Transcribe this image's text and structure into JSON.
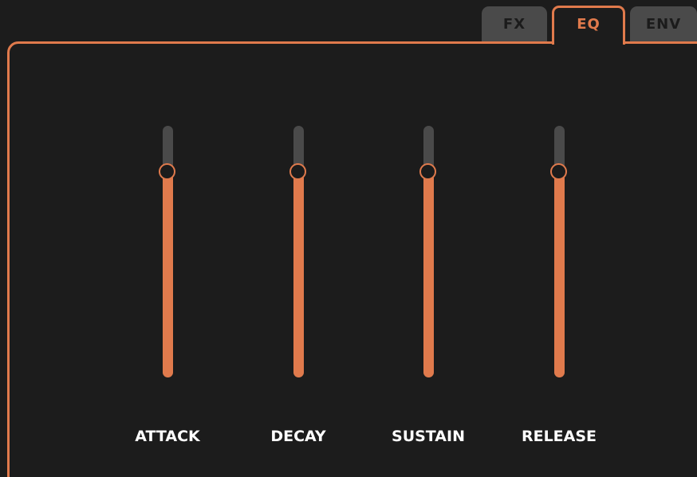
{
  "tabs": [
    {
      "label": "FX",
      "active": false
    },
    {
      "label": "EQ",
      "active": true
    },
    {
      "label": "ENV",
      "active": false
    }
  ],
  "sliders": [
    {
      "label": "ATTACK",
      "value": 0.82
    },
    {
      "label": "DECAY",
      "value": 0.82
    },
    {
      "label": "SUSTAIN",
      "value": 0.82
    },
    {
      "label": "RELEASE",
      "value": 0.82
    }
  ],
  "colors": {
    "accent": "#e07a4c",
    "background": "#1c1c1c",
    "track": "#4a4a4a",
    "inactive_tab": "#4a4a4a",
    "label_text": "#ffffff"
  }
}
